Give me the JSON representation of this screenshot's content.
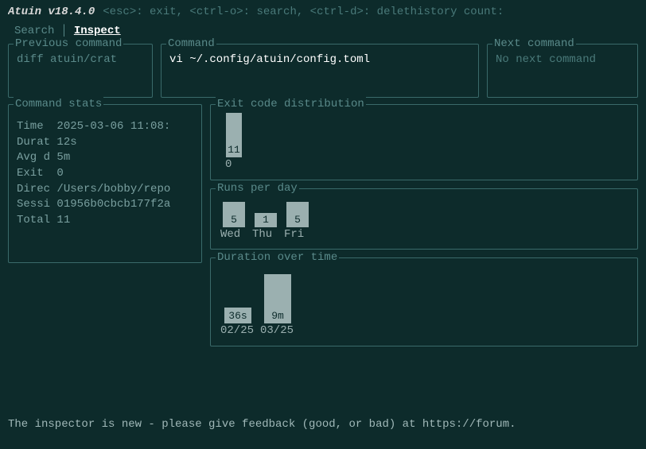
{
  "app": {
    "title": "Atuin v18.4.0",
    "help": "<esc>: exit, <ctrl-o>: search, <ctrl-d>: delethistory count:"
  },
  "tabs": {
    "search": "Search",
    "inspect": "Inspect"
  },
  "commands": {
    "prev_title": "Previous command",
    "prev_value": "diff atuin/crat",
    "curr_title": "Command",
    "curr_value": "vi ~/.config/atuin/config.toml",
    "next_title": "Next command",
    "next_value": "No next command"
  },
  "stats": {
    "title": "Command stats",
    "time_label": "Time ",
    "time_value": "2025-03-06 11:08:",
    "durat_label": "Durat",
    "durat_value": "12s",
    "avgd_label": "Avg d",
    "avgd_value": "5m",
    "exit_label": "Exit ",
    "exit_value": "0",
    "direc_label": "Direc",
    "direc_value": "/Users/bobby/repo",
    "sessi_label": "Sessi",
    "sessi_value": "01956b0cbcb177f2a",
    "total_label": "Total",
    "total_value": "11"
  },
  "chart_data": [
    {
      "type": "bar",
      "title": "Exit code distribution",
      "categories": [
        "0"
      ],
      "values": [
        11
      ]
    },
    {
      "type": "bar",
      "title": "Runs per day",
      "categories": [
        "Wed",
        "Thu",
        "Fri"
      ],
      "values": [
        5,
        1,
        5
      ]
    },
    {
      "type": "bar",
      "title": "Duration over time",
      "categories": [
        "02/25",
        "03/25"
      ],
      "values": [
        "36s",
        "9m"
      ]
    }
  ],
  "footer": "The inspector is new - please give feedback (good, or bad) at https://forum."
}
